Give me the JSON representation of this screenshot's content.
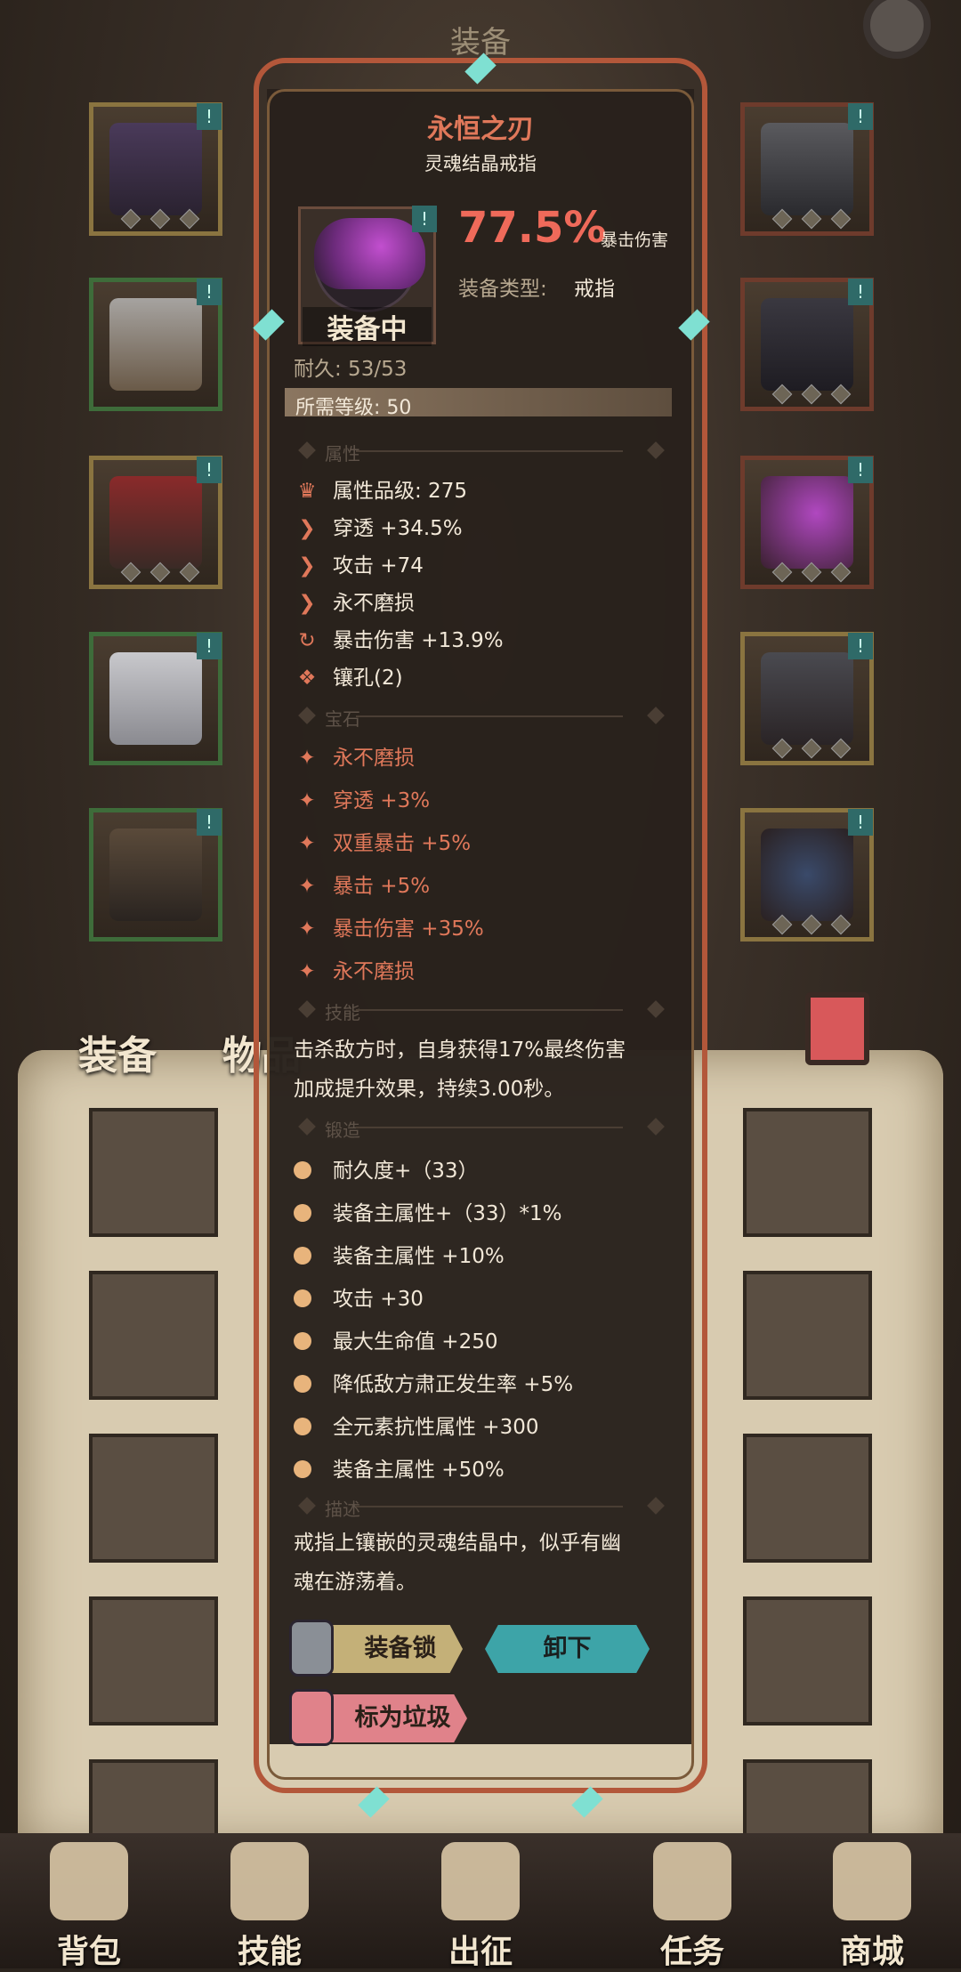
{
  "header": {
    "plate_text": "装备",
    "accent": "#b3573a"
  },
  "tabs": {
    "equipment": "装备",
    "items": "物品"
  },
  "tooltip": {
    "item_name": "永恒之刃",
    "item_subtitle": "灵魂结晶戒指",
    "equipped_label": "装备中",
    "main_stat_value": "77.5%",
    "main_stat_label": "暴击伤害",
    "equip_type_label": "装备类型:",
    "equip_type_value": "戒指",
    "durability": "耐久: 53/53",
    "required_level_label": "所需等级:",
    "required_level_value": "50",
    "sections": {
      "attributes": "属性",
      "gems": "宝石",
      "skill": "技能",
      "forge": "锻造",
      "description": "描述"
    },
    "attributes": [
      {
        "icon": "crown-icon",
        "glyph": "♛",
        "text": "属性品级: 275"
      },
      {
        "icon": "penetration-icon",
        "glyph": "❯",
        "text": "穿透 +34.5%"
      },
      {
        "icon": "attack-icon",
        "glyph": "❯",
        "text": "攻击 +74"
      },
      {
        "icon": "indestructible-icon",
        "glyph": "❯",
        "text": "永不磨损"
      },
      {
        "icon": "crit-damage-icon",
        "glyph": "↻",
        "text": "暴击伤害 +13.9%"
      },
      {
        "icon": "socket-icon",
        "glyph": "❖",
        "text": "镶孔(2)"
      }
    ],
    "gems": [
      "永不磨损",
      "穿透 +3%",
      "双重暴击 +5%",
      "暴击 +5%",
      "暴击伤害 +35%",
      "永不磨损"
    ],
    "skill_text_1": "击杀敌方时，自身获得17%最终伤害",
    "skill_text_2": "加成提升效果，持续3.00秒。",
    "forge": [
      "耐久度+（33）",
      "装备主属性+（33）*1%",
      "装备主属性 +10%",
      "攻击 +30",
      "最大生命值 +250",
      "降低敌方肃正发生率 +5%",
      "全元素抗性属性 +300",
      "装备主属性 +50%"
    ],
    "description_1": "戒指上镶嵌的灵魂结晶中，似乎有幽",
    "description_2": "魂在游荡着。",
    "buttons": {
      "lock": "装备锁",
      "unequip": "卸下",
      "junk": "标为垃圾"
    }
  },
  "slot_badge": "!",
  "bottom_nav": [
    {
      "label": "背包",
      "icon": "backpack-icon"
    },
    {
      "label": "技能",
      "icon": "skill-book-icon"
    },
    {
      "label": "出征",
      "icon": "expedition-icon"
    },
    {
      "label": "任务",
      "icon": "quest-icon"
    },
    {
      "label": "商城",
      "icon": "shop-icon"
    }
  ]
}
